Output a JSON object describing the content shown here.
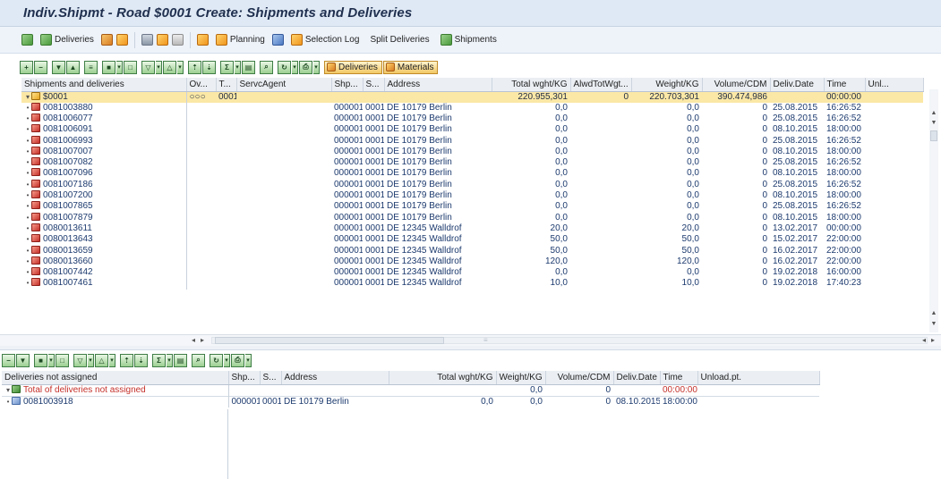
{
  "window": {
    "title": "Indiv.Shipmt - Road $0001 Create: Shipments and Deliveries"
  },
  "toolbar": {
    "deliveries_label": "Deliveries",
    "planning_label": "Planning",
    "selection_log_label": "Selection Log",
    "split_deliveries_label": "Split Deliveries",
    "shipments_label": "Shipments"
  },
  "upper_grid": {
    "buttons": {
      "deliveries": "Deliveries",
      "materials": "Materials"
    },
    "columns": [
      "Shipments and deliveries",
      "Ov...",
      "T...",
      "ServcAgent",
      "Shp...",
      "S...",
      "Address",
      "Total wght/KG",
      "AlwdTotWgt...",
      "Weight/KG",
      "Volume/CDM",
      "Deliv.Date",
      "Time",
      "Unl..."
    ],
    "shipment_row": {
      "name": "$0001",
      "ov": "○○○",
      "t": "0001",
      "total": "220.955,301",
      "alwd": "0",
      "weight": "220.703,301",
      "volume": "390.474,986",
      "time": "00:00:00"
    },
    "rows": [
      {
        "name": "0081003880",
        "shp": "000001",
        "s": "0001",
        "address": "DE 10179 Berlin",
        "total": "0,0",
        "weight": "0,0",
        "volume": "0",
        "date": "25.08.2015",
        "time": "16:26:52"
      },
      {
        "name": "0081006077",
        "shp": "000001",
        "s": "0001",
        "address": "DE 10179 Berlin",
        "total": "0,0",
        "weight": "0,0",
        "volume": "0",
        "date": "25.08.2015",
        "time": "16:26:52"
      },
      {
        "name": "0081006091",
        "shp": "000001",
        "s": "0001",
        "address": "DE 10179 Berlin",
        "total": "0,0",
        "weight": "0,0",
        "volume": "0",
        "date": "08.10.2015",
        "time": "18:00:00"
      },
      {
        "name": "0081006993",
        "shp": "000001",
        "s": "0001",
        "address": "DE 10179 Berlin",
        "total": "0,0",
        "weight": "0,0",
        "volume": "0",
        "date": "25.08.2015",
        "time": "16:26:52"
      },
      {
        "name": "0081007007",
        "shp": "000001",
        "s": "0001",
        "address": "DE 10179 Berlin",
        "total": "0,0",
        "weight": "0,0",
        "volume": "0",
        "date": "08.10.2015",
        "time": "18:00:00"
      },
      {
        "name": "0081007082",
        "shp": "000001",
        "s": "0001",
        "address": "DE 10179 Berlin",
        "total": "0,0",
        "weight": "0,0",
        "volume": "0",
        "date": "25.08.2015",
        "time": "16:26:52"
      },
      {
        "name": "0081007096",
        "shp": "000001",
        "s": "0001",
        "address": "DE 10179 Berlin",
        "total": "0,0",
        "weight": "0,0",
        "volume": "0",
        "date": "08.10.2015",
        "time": "18:00:00"
      },
      {
        "name": "0081007186",
        "shp": "000001",
        "s": "0001",
        "address": "DE 10179 Berlin",
        "total": "0,0",
        "weight": "0,0",
        "volume": "0",
        "date": "25.08.2015",
        "time": "16:26:52"
      },
      {
        "name": "0081007200",
        "shp": "000001",
        "s": "0001",
        "address": "DE 10179 Berlin",
        "total": "0,0",
        "weight": "0,0",
        "volume": "0",
        "date": "08.10.2015",
        "time": "18:00:00"
      },
      {
        "name": "0081007865",
        "shp": "000001",
        "s": "0001",
        "address": "DE 10179 Berlin",
        "total": "0,0",
        "weight": "0,0",
        "volume": "0",
        "date": "25.08.2015",
        "time": "16:26:52"
      },
      {
        "name": "0081007879",
        "shp": "000001",
        "s": "0001",
        "address": "DE 10179 Berlin",
        "total": "0,0",
        "weight": "0,0",
        "volume": "0",
        "date": "08.10.2015",
        "time": "18:00:00"
      },
      {
        "name": "0080013611",
        "shp": "000001",
        "s": "0001",
        "address": "DE 12345 Walldrof",
        "total": "20,0",
        "weight": "20,0",
        "volume": "0",
        "date": "13.02.2017",
        "time": "00:00:00"
      },
      {
        "name": "0080013643",
        "shp": "000001",
        "s": "0001",
        "address": "DE 12345 Walldrof",
        "total": "50,0",
        "weight": "50,0",
        "volume": "0",
        "date": "15.02.2017",
        "time": "22:00:00"
      },
      {
        "name": "0080013659",
        "shp": "000001",
        "s": "0001",
        "address": "DE 12345 Walldrof",
        "total": "50,0",
        "weight": "50,0",
        "volume": "0",
        "date": "16.02.2017",
        "time": "22:00:00"
      },
      {
        "name": "0080013660",
        "shp": "000001",
        "s": "0001",
        "address": "DE 12345 Walldrof",
        "total": "120,0",
        "weight": "120,0",
        "volume": "0",
        "date": "16.02.2017",
        "time": "22:00:00"
      },
      {
        "name": "0081007442",
        "shp": "000001",
        "s": "0001",
        "address": "DE 12345 Walldrof",
        "total": "0,0",
        "weight": "0,0",
        "volume": "0",
        "date": "19.02.2018",
        "time": "16:00:00"
      },
      {
        "name": "0081007461",
        "shp": "000001",
        "s": "0001",
        "address": "DE 12345 Walldrof",
        "total": "10,0",
        "weight": "10,0",
        "volume": "0",
        "date": "19.02.2018",
        "time": "17:40:23"
      }
    ]
  },
  "lower_grid": {
    "columns": [
      "Deliveries not assigned",
      "Shp...",
      "S...",
      "Address",
      "Total wght/KG",
      "Weight/KG",
      "Volume/CDM",
      "Deliv.Date",
      "Time",
      "Unload.pt."
    ],
    "total_row": {
      "label": "Total of deliveries not assigned",
      "weight": "0,0",
      "volume": "0",
      "time": "00:00:00"
    },
    "rows": [
      {
        "name": "0081003918",
        "shp": "000001",
        "s": "0001",
        "address": "DE 10179 Berlin",
        "total": "0,0",
        "weight": "0,0",
        "volume": "0",
        "date": "08.10.2015",
        "time": "18:00:00"
      }
    ]
  },
  "colors": {
    "title_bar": "#dfe9f5",
    "selected_row": "#fbe8a6",
    "link_text": "#1c3a6e",
    "red_text": "#c4302a"
  }
}
